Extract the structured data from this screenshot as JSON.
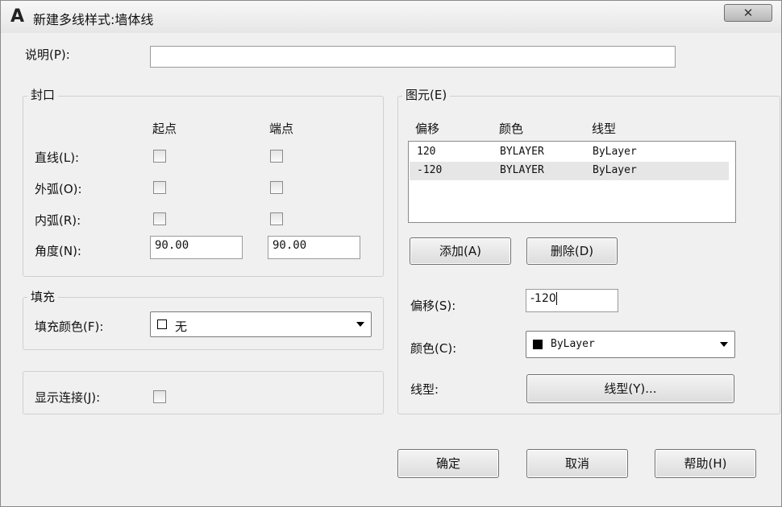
{
  "window": {
    "title": "新建多线样式:墙体线",
    "close_glyph": "✕"
  },
  "description": {
    "label": "说明(P):",
    "value": ""
  },
  "caps": {
    "title": "封口",
    "col_start": "起点",
    "col_end": "端点",
    "line_label": "直线(L):",
    "outer_arc_label": "外弧(O):",
    "inner_arc_label": "内弧(R):",
    "angle_label": "角度(N):",
    "angle_start": "90.00",
    "angle_end": "90.00"
  },
  "fill": {
    "title": "填充",
    "color_label": "填充颜色(F):",
    "color_value": "无"
  },
  "show_joints": {
    "label": "显示连接(J):"
  },
  "elements": {
    "title": "图元(E)",
    "headers": [
      "偏移",
      "颜色",
      "线型"
    ],
    "rows": [
      {
        "offset": "120",
        "color": "BYLAYER",
        "linetype": "ByLayer"
      },
      {
        "offset": "-120",
        "color": "BYLAYER",
        "linetype": "ByLayer"
      }
    ],
    "add_label": "添加(A)",
    "delete_label": "删除(D)",
    "offset_label": "偏移(S):",
    "offset_value": "-120",
    "color_label": "颜色(C):",
    "color_value": "ByLayer",
    "color_swatch": "#000000",
    "linetype_label": "线型:",
    "linetype_button": "线型(Y)..."
  },
  "footer": {
    "ok": "确定",
    "cancel": "取消",
    "help": "帮助(H)"
  }
}
